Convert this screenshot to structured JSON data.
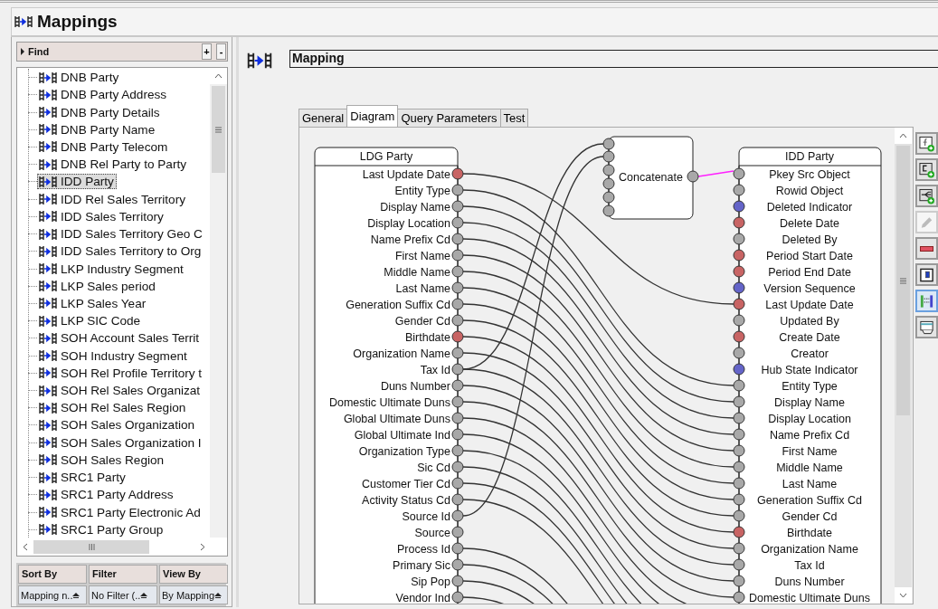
{
  "window": {
    "title": "Mappings"
  },
  "find": {
    "label": "Find",
    "add": "+",
    "remove": "-"
  },
  "mappings": [
    {
      "label": "DNB Party",
      "selected": false
    },
    {
      "label": "DNB Party Address",
      "selected": false
    },
    {
      "label": "DNB Party Details",
      "selected": false
    },
    {
      "label": "DNB Party Name",
      "selected": false
    },
    {
      "label": "DNB Party Telecom",
      "selected": false
    },
    {
      "label": "DNB Rel Party to Party",
      "selected": false
    },
    {
      "label": "IDD Party",
      "selected": true
    },
    {
      "label": "IDD Rel Sales Territory",
      "selected": false
    },
    {
      "label": "IDD Sales Territory",
      "selected": false
    },
    {
      "label": "IDD Sales Territory Geo C",
      "selected": false
    },
    {
      "label": "IDD Sales Territory to Org",
      "selected": false
    },
    {
      "label": "LKP Industry Segment",
      "selected": false
    },
    {
      "label": "LKP Sales period",
      "selected": false
    },
    {
      "label": "LKP Sales Year",
      "selected": false
    },
    {
      "label": "LKP SIC Code",
      "selected": false
    },
    {
      "label": "SOH Account Sales Territ",
      "selected": false
    },
    {
      "label": "SOH Industry Segment",
      "selected": false
    },
    {
      "label": "SOH Rel Profile Territory t",
      "selected": false
    },
    {
      "label": "SOH Rel Sales Organizat",
      "selected": false
    },
    {
      "label": "SOH Rel Sales Region",
      "selected": false
    },
    {
      "label": "SOH Sales Organization",
      "selected": false
    },
    {
      "label": "SOH Sales Organization I",
      "selected": false
    },
    {
      "label": "SOH Sales Region",
      "selected": false
    },
    {
      "label": "SRC1 Party",
      "selected": false
    },
    {
      "label": "SRC1 Party Address",
      "selected": false
    },
    {
      "label": "SRC1 Party Electronic Ad",
      "selected": false
    },
    {
      "label": "SRC1 Party Group",
      "selected": false
    }
  ],
  "list_options": [
    {
      "header": "Sort By",
      "value": "Mapping n.."
    },
    {
      "header": "Filter",
      "value": "No Filter (.."
    },
    {
      "header": "View By",
      "value": "By Mapping"
    }
  ],
  "mapping": {
    "title": "Mapping"
  },
  "tabs": [
    {
      "label": "General",
      "selected": false
    },
    {
      "label": "Diagram",
      "selected": true
    },
    {
      "label": "Query Parameters",
      "selected": false
    },
    {
      "label": "Test",
      "selected": false
    }
  ],
  "diagram": {
    "source": {
      "title": "LDG Party",
      "fields": [
        {
          "name": "Last Update Date",
          "color": "#c86464"
        },
        {
          "name": "Entity Type",
          "color": "#a8a8a8"
        },
        {
          "name": "Display Name",
          "color": "#a8a8a8"
        },
        {
          "name": "Display Location",
          "color": "#a8a8a8"
        },
        {
          "name": "Name Prefix Cd",
          "color": "#a8a8a8"
        },
        {
          "name": "First Name",
          "color": "#a8a8a8"
        },
        {
          "name": "Middle Name",
          "color": "#a8a8a8"
        },
        {
          "name": "Last Name",
          "color": "#a8a8a8"
        },
        {
          "name": "Generation Suffix Cd",
          "color": "#a8a8a8"
        },
        {
          "name": "Gender Cd",
          "color": "#a8a8a8"
        },
        {
          "name": "Birthdate",
          "color": "#c86464"
        },
        {
          "name": "Organization Name",
          "color": "#a8a8a8"
        },
        {
          "name": "Tax Id",
          "color": "#a8a8a8"
        },
        {
          "name": "Duns Number",
          "color": "#a8a8a8"
        },
        {
          "name": "Domestic Ultimate Duns",
          "color": "#a8a8a8"
        },
        {
          "name": "Global Ultimate Duns",
          "color": "#a8a8a8"
        },
        {
          "name": "Global Ultimate Ind",
          "color": "#a8a8a8"
        },
        {
          "name": "Organization Type",
          "color": "#a8a8a8"
        },
        {
          "name": "Sic Cd",
          "color": "#a8a8a8"
        },
        {
          "name": "Customer Tier Cd",
          "color": "#a8a8a8"
        },
        {
          "name": "Activity Status Cd",
          "color": "#a8a8a8"
        },
        {
          "name": "Source Id",
          "color": "#a8a8a8"
        },
        {
          "name": "Source",
          "color": "#a8a8a8"
        },
        {
          "name": "Process Id",
          "color": "#a8a8a8"
        },
        {
          "name": "Primary Sic",
          "color": "#a8a8a8"
        },
        {
          "name": "Sip Pop",
          "color": "#a8a8a8"
        },
        {
          "name": "Vendor Ind",
          "color": "#a8a8a8"
        }
      ]
    },
    "function": {
      "label": "Concatenate"
    },
    "target": {
      "title": "IDD Party",
      "fields": [
        {
          "name": "Pkey Src Object",
          "color": "#a8a8a8"
        },
        {
          "name": "Rowid Object",
          "color": "#a8a8a8"
        },
        {
          "name": "Deleted Indicator",
          "color": "#6464c8"
        },
        {
          "name": "Delete Date",
          "color": "#c86464"
        },
        {
          "name": "Deleted By",
          "color": "#a8a8a8"
        },
        {
          "name": "Period Start Date",
          "color": "#c86464"
        },
        {
          "name": "Period End Date",
          "color": "#c86464"
        },
        {
          "name": "Version Sequence",
          "color": "#6464c8"
        },
        {
          "name": "Last Update Date",
          "color": "#c86464"
        },
        {
          "name": "Updated By",
          "color": "#a8a8a8"
        },
        {
          "name": "Create Date",
          "color": "#c86464"
        },
        {
          "name": "Creator",
          "color": "#a8a8a8"
        },
        {
          "name": "Hub State Indicator",
          "color": "#6464c8"
        },
        {
          "name": "Entity Type",
          "color": "#a8a8a8"
        },
        {
          "name": "Display Name",
          "color": "#a8a8a8"
        },
        {
          "name": "Display Location",
          "color": "#a8a8a8"
        },
        {
          "name": "Name Prefix Cd",
          "color": "#a8a8a8"
        },
        {
          "name": "First Name",
          "color": "#a8a8a8"
        },
        {
          "name": "Middle Name",
          "color": "#a8a8a8"
        },
        {
          "name": "Last Name",
          "color": "#a8a8a8"
        },
        {
          "name": "Generation Suffix Cd",
          "color": "#a8a8a8"
        },
        {
          "name": "Gender Cd",
          "color": "#a8a8a8"
        },
        {
          "name": "Birthdate",
          "color": "#c86464"
        },
        {
          "name": "Organization Name",
          "color": "#a8a8a8"
        },
        {
          "name": "Tax Id",
          "color": "#a8a8a8"
        },
        {
          "name": "Duns Number",
          "color": "#a8a8a8"
        },
        {
          "name": "Domestic Ultimate Duns",
          "color": "#a8a8a8"
        }
      ]
    }
  },
  "toolbar": [
    {
      "kind": "add-function",
      "disabled": false,
      "selected": false
    },
    {
      "kind": "add-constant",
      "disabled": false,
      "selected": false
    },
    {
      "kind": "add-conditional",
      "disabled": false,
      "selected": false
    },
    {
      "kind": "edit",
      "disabled": true,
      "selected": false
    },
    {
      "kind": "delete",
      "disabled": false,
      "selected": false
    },
    {
      "kind": "properties",
      "disabled": false,
      "selected": false
    },
    {
      "kind": "auto-layout",
      "disabled": false,
      "selected": true
    },
    {
      "kind": "print",
      "disabled": false,
      "selected": false
    }
  ]
}
